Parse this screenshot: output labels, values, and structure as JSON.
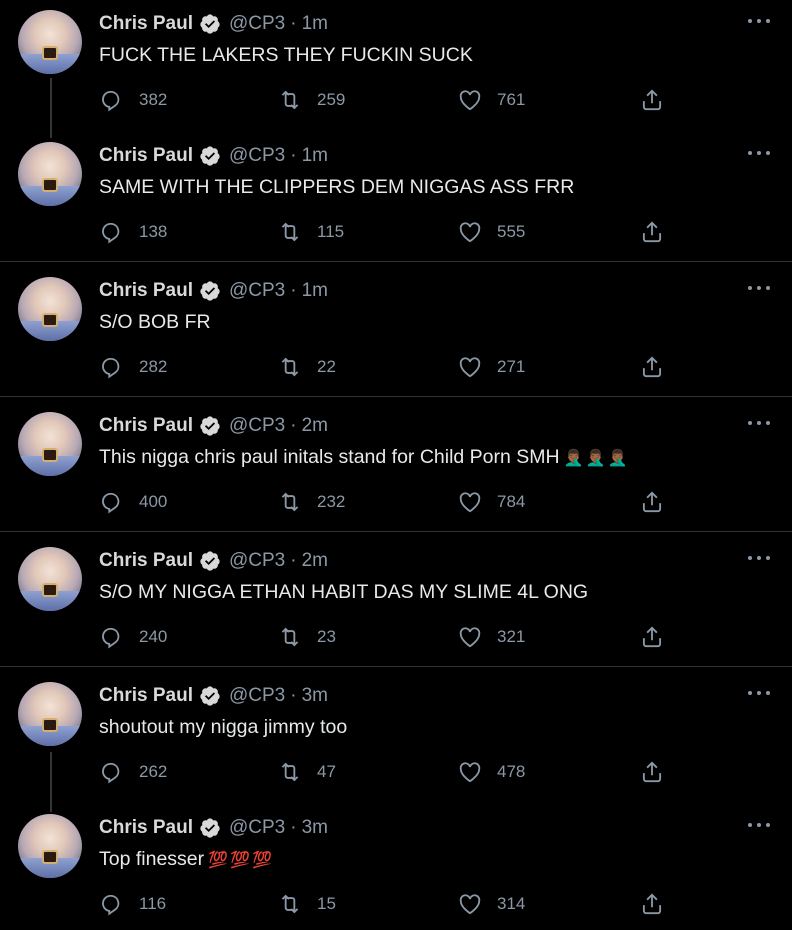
{
  "author": {
    "name": "Chris Paul",
    "handle": "@CP3",
    "separator": "·"
  },
  "icons": {
    "reply": "reply-icon",
    "retweet": "retweet-icon",
    "like": "heart-icon",
    "share": "share-icon",
    "verified": "verified-badge-icon",
    "more": "more-options-icon"
  },
  "colors": {
    "background": "#000000",
    "text": "#e7e9ea",
    "muted": "#8b98a5",
    "divider": "#2f3336"
  },
  "tweets": [
    {
      "time": "1m",
      "text": "FUCK THE LAKERS THEY FUCKIN SUCK",
      "emoji": "",
      "replies": "382",
      "retweets": "259",
      "likes": "761"
    },
    {
      "time": "1m",
      "text": "SAME WITH THE CLIPPERS DEM NIGGAS ASS FRR",
      "emoji": "",
      "replies": "138",
      "retweets": "115",
      "likes": "555"
    },
    {
      "time": "1m",
      "text": "S/O BOB FR",
      "emoji": "",
      "replies": "282",
      "retweets": "22",
      "likes": "271"
    },
    {
      "time": "2m",
      "text": "This nigga chris paul initals stand for Child Porn SMH",
      "emoji": "🤦🏾‍♂️🤦🏾‍♂️🤦🏾‍♂️",
      "replies": "400",
      "retweets": "232",
      "likes": "784"
    },
    {
      "time": "2m",
      "text": "S/O MY NIGGA ETHAN HABIT DAS MY SLIME 4L ONG",
      "emoji": "",
      "replies": "240",
      "retweets": "23",
      "likes": "321"
    },
    {
      "time": "3m",
      "text": "shoutout my nigga jimmy too",
      "emoji": "",
      "replies": "262",
      "retweets": "47",
      "likes": "478"
    },
    {
      "time": "3m",
      "text": "Top finesser",
      "emoji": "💯💯💯",
      "replies": "116",
      "retweets": "15",
      "likes": "314"
    }
  ]
}
